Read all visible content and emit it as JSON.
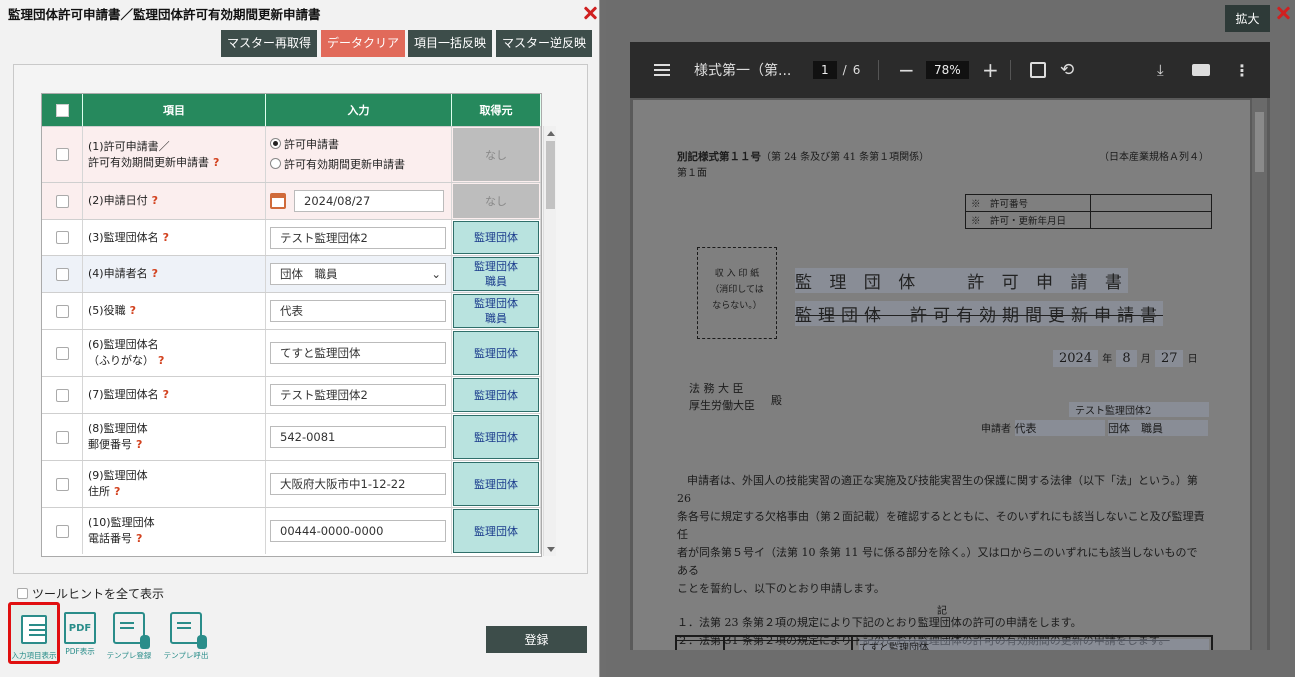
{
  "dialog": {
    "title": "監理団体許可申請書／監理団体許可有効期間更新申請書",
    "toolbar": {
      "master_reload": "マスター再取得",
      "data_clear": "データクリア",
      "batch_apply": "項目一括反映",
      "master_reverse": "マスター逆反映"
    },
    "grid": {
      "headers": {
        "item": "項目",
        "input": "入力",
        "source": "取得元"
      },
      "rows": [
        {
          "label1": "(1)許可申請書／",
          "label2": "許可有効期間更新申請書",
          "radio1": "許可申請書",
          "radio2": "許可有効期間更新申請書",
          "source": "なし"
        },
        {
          "label1": "(2)申請日付",
          "value": "2024/08/27",
          "source": "なし"
        },
        {
          "label1": "(3)監理団体名",
          "value": "テスト監理団体2",
          "source": "監理団体"
        },
        {
          "label1": "(4)申請者名",
          "value": "団体　職員",
          "source1": "監理団体",
          "source2": "職員"
        },
        {
          "label1": "(5)役職",
          "value": "代表",
          "source1": "監理団体",
          "source2": "職員"
        },
        {
          "label1": "(6)監理団体名",
          "label2": "（ふりがな）",
          "value": "てすと監理団体",
          "source": "監理団体"
        },
        {
          "label1": "(7)監理団体名",
          "value": "テスト監理団体2",
          "source": "監理団体"
        },
        {
          "label1": "(8)監理団体",
          "label2": "郵便番号",
          "value": "542-0081",
          "source": "監理団体"
        },
        {
          "label1": "(9)監理団体",
          "label2": "住所",
          "value": "大阪府大阪市中1-12-22",
          "source": "監理団体"
        },
        {
          "label1": "(10)監理団体",
          "label2": "電話番号",
          "value": "00444-0000-0000",
          "source": "監理団体"
        }
      ],
      "help_mark": "?"
    },
    "tooltip_toggle": "ツールヒントを全て表示",
    "bottom_icons": {
      "input_view": "入力項目表示",
      "pdf_view": "PDF表示",
      "pdf_glyph": "PDF",
      "template_register": "テンプレ登録",
      "template_call": "テンプレ呼出"
    },
    "submit": "登録"
  },
  "viewer": {
    "expand": "拡大",
    "doc_title": "様式第一（第...",
    "page_current": "1",
    "page_sep": "/",
    "page_total": "6",
    "zoom": "78%",
    "paper": {
      "form_no": "別記様式第１１号",
      "form_ref": "（第 24 条及び第 41 条第１項関係）",
      "paper_size": "（日本産業規格Ａ列４）",
      "side": "第１面",
      "permit_no_label": "※　許可番号",
      "permit_date_label": "※　許可・更新年月日",
      "stamp_1": "収 入 印 紙",
      "stamp_2": "（消印しては",
      "stamp_3": "ならない。）",
      "title_1": "監 理 団 体　　許 可 申 請 書",
      "title_2": "監理団体　許可有効期間更新申請書",
      "date_year": "2024",
      "date_year_unit": "年",
      "date_month": "8",
      "date_month_unit": "月",
      "date_day": "27",
      "date_day_unit": "日",
      "addressee_1": "法 務 大 臣",
      "addressee_2": "厚生労働大臣",
      "honorific": "殿",
      "applicant_org": "テスト監理団体2",
      "applicant_label": "申請者",
      "applicant_role": "代表",
      "applicant_name": "団体　職員",
      "body_1": "申請者は、外国人の技能実習の適正な実施及び技能実習生の保護に関する法律（以下「法」という。）第 26",
      "body_2": "条各号に規定する欠格事由（第２面記載）を確認するとともに、そのいずれにも該当しないこと及び監理責任",
      "body_3": "者が同条第５号イ（法第 10 条第 11 号に係る部分を除く。）又はロからニのいずれにも該当しないものである",
      "body_4": "ことを誓約し、以下のとおり申請します。",
      "item_1": "１．法第 23 条第２項の規定により下記のとおり監理団体の許可の申請をします。",
      "item_2": "２．法第 31 条第２項の規定により下記のとおり監理団体の許可の有効期間の更新の申請をします。",
      "ki": "記",
      "table_cell": "てすと監理団体"
    }
  }
}
